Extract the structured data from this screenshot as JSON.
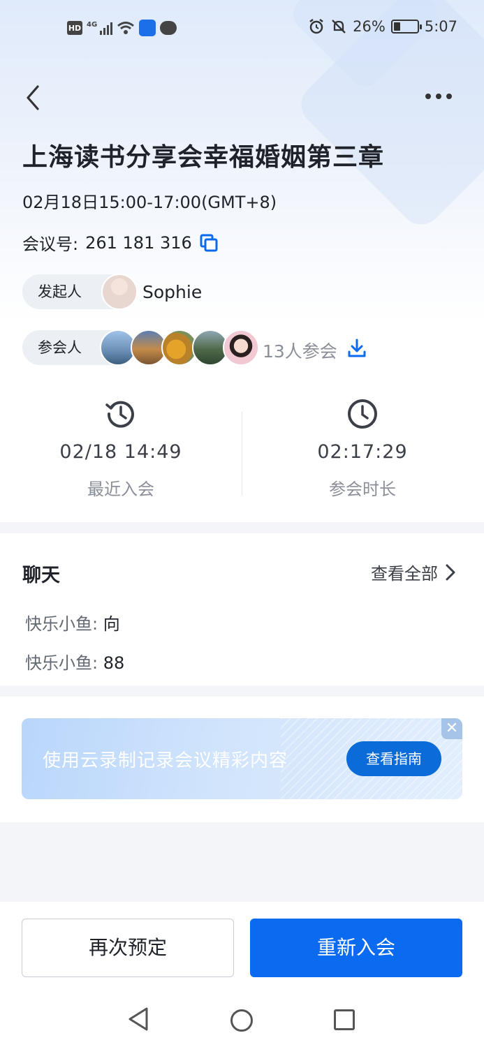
{
  "status_bar": {
    "network": "4G",
    "hd": "HD",
    "battery": "26%",
    "battery_level": 0.26,
    "time": "5:07"
  },
  "header": {
    "back_icon": "chevron-left-icon",
    "more_icon": "more-dots-icon"
  },
  "meeting": {
    "title": "上海读书分享会幸福婚姻第三章",
    "time": "02月18日15:00-17:00(GMT+8)",
    "id_label": "会议号:",
    "id_value": "261 181 316",
    "host_label": "发起人",
    "host_name": "Sophie",
    "attendees_label": "参会人",
    "attendees_count": "13人参会"
  },
  "stats": {
    "recent_join_value": "02/18 14:49",
    "recent_join_label": "最近入会",
    "duration_value": "02:17:29",
    "duration_label": "参会时长"
  },
  "chat": {
    "title": "聊天",
    "view_all": "查看全部",
    "messages": [
      {
        "sender": "快乐小鱼:",
        "text": "向"
      },
      {
        "sender": "快乐小鱼:",
        "text": "88"
      }
    ]
  },
  "banner": {
    "text": "使用云录制记录会议精彩内容",
    "button": "查看指南",
    "close": "✕"
  },
  "actions": {
    "rebook": "再次预定",
    "rejoin": "重新入会"
  },
  "colors": {
    "primary": "#0b6bf0",
    "text": "#1f2329",
    "muted": "#8a8f99"
  }
}
